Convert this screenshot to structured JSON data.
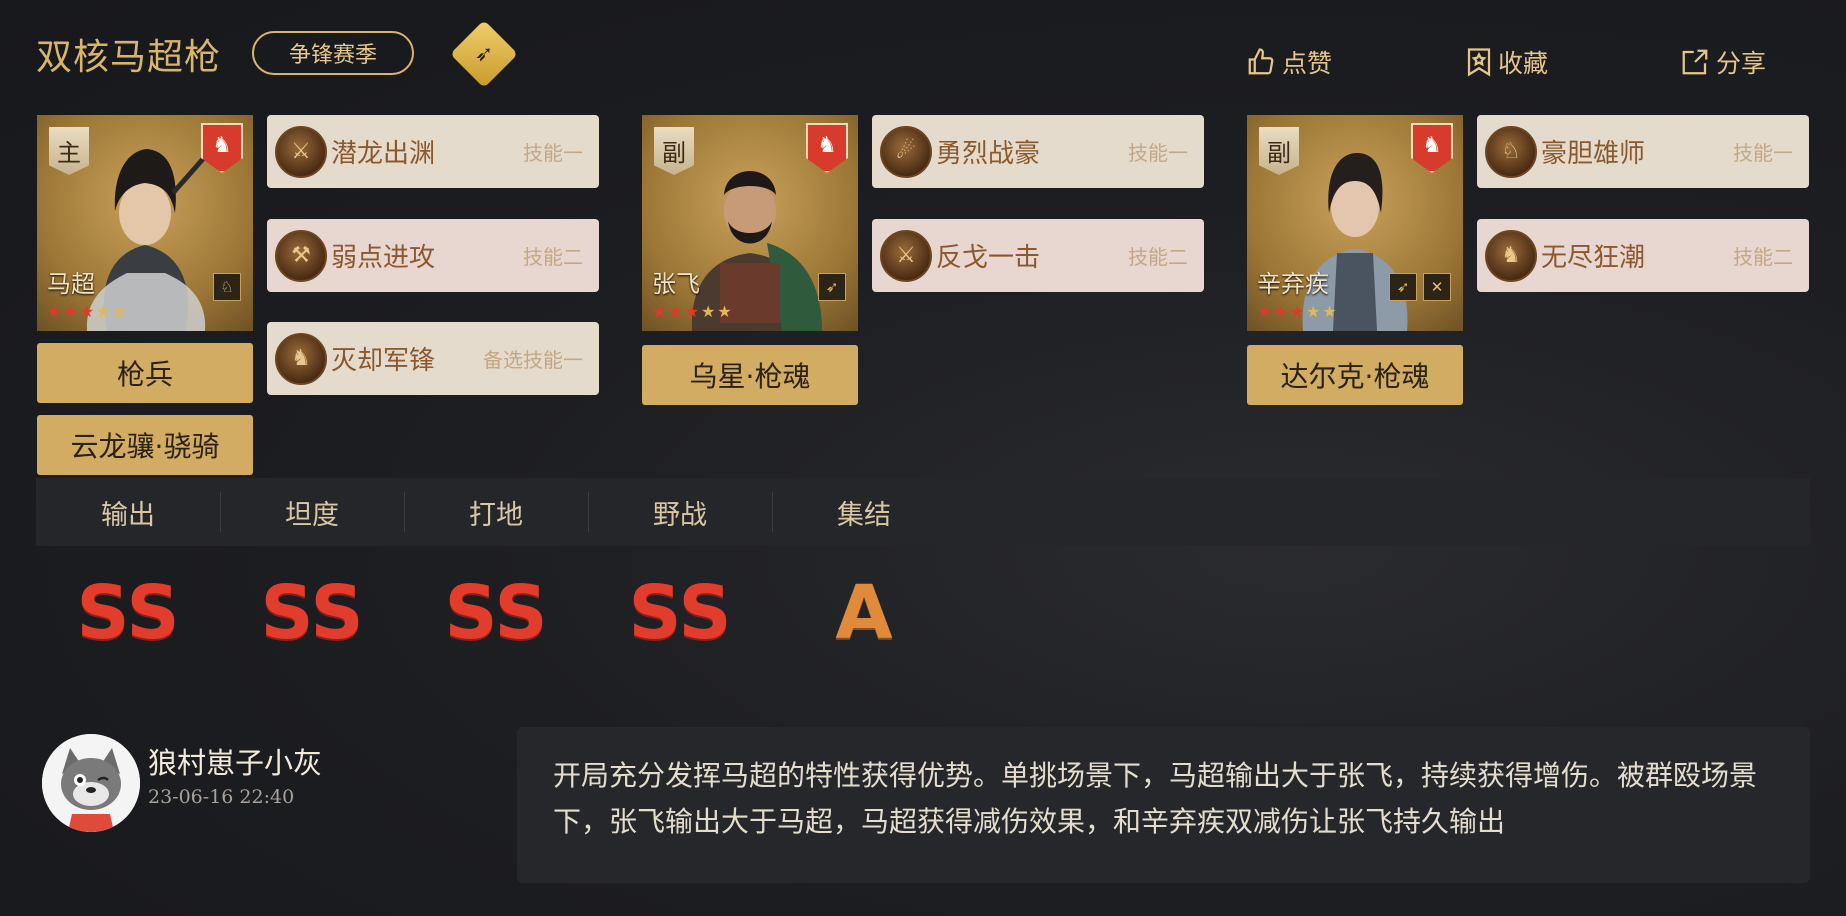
{
  "header": {
    "title": "双核马超枪",
    "season_tag": "争锋赛季",
    "type_icon": "spear-icon",
    "actions": {
      "like": "点赞",
      "favorite": "收藏",
      "share": "分享"
    }
  },
  "heroes": [
    {
      "role": "主",
      "name": "马超",
      "stars_red": 3,
      "stars_gold": 2,
      "faction_icon": "lion-crest-icon",
      "troops": [
        "枪兵",
        "云龙骧·骁骑"
      ],
      "skills": [
        {
          "name": "潜龙出渊",
          "slot": "技能一"
        },
        {
          "name": "弱点进攻",
          "slot": "技能二"
        },
        {
          "name": "灭却军锋",
          "slot": "备选技能一"
        }
      ]
    },
    {
      "role": "副",
      "name": "张飞",
      "stars_red": 3,
      "stars_gold": 2,
      "faction_icon": "lion-crest-icon",
      "troops": [
        "乌星·枪魂"
      ],
      "skills": [
        {
          "name": "勇烈战豪",
          "slot": "技能一"
        },
        {
          "name": "反戈一击",
          "slot": "技能二"
        }
      ]
    },
    {
      "role": "副",
      "name": "辛弃疾",
      "stars_red": 3,
      "stars_gold": 2,
      "faction_icon": "lion-crest-icon",
      "troops": [
        "达尔克·枪魂"
      ],
      "skills": [
        {
          "name": "豪胆雄师",
          "slot": "技能一"
        },
        {
          "name": "无尽狂潮",
          "slot": "技能二"
        }
      ]
    }
  ],
  "stats": [
    {
      "label": "输出",
      "grade": "SS"
    },
    {
      "label": "坦度",
      "grade": "SS"
    },
    {
      "label": "打地",
      "grade": "SS"
    },
    {
      "label": "野战",
      "grade": "SS"
    },
    {
      "label": "集结",
      "grade": "A"
    }
  ],
  "author": {
    "name": "狼村崽子小灰",
    "time": "23-06-16 22:40"
  },
  "comment": "开局充分发挥马超的特性获得优势。单挑场景下，马超输出大于张飞，持续获得增伤。被群殴场景下，张飞输出大于马超，马超获得减伤效果，和辛弃疾双减伤让张飞持久输出",
  "colors": {
    "accent_gold": "#d2ac62",
    "grade_red": "#e23c2c",
    "grade_orange": "#e08a3c"
  }
}
